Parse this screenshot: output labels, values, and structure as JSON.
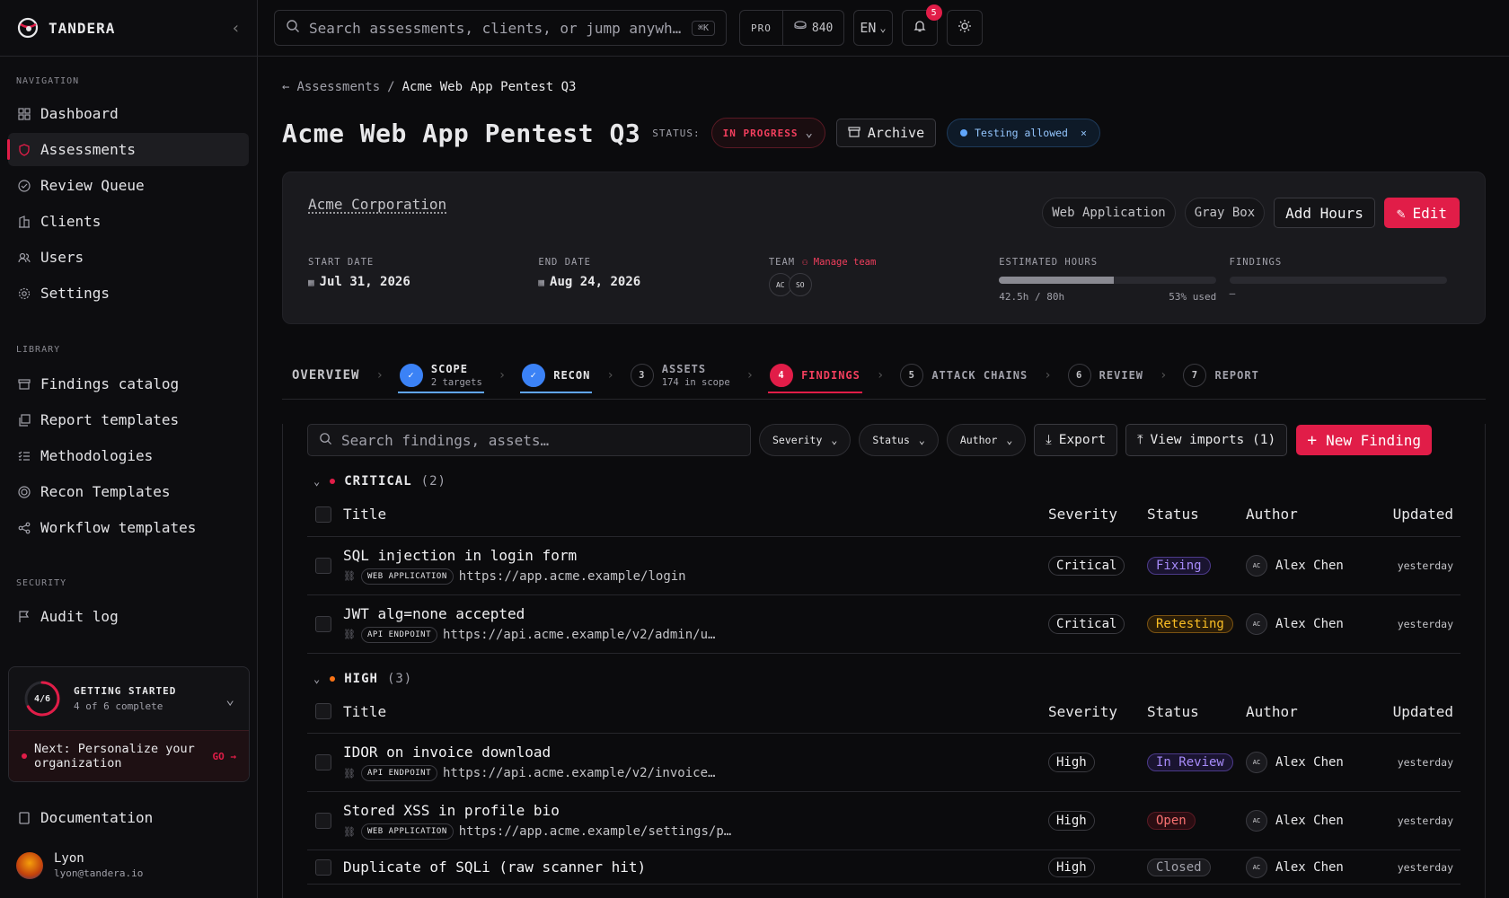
{
  "app": {
    "name": "TANDERA"
  },
  "sidebar": {
    "nav_heading": "NAVIGATION",
    "nav": [
      {
        "label": "Dashboard",
        "icon": "grid-icon"
      },
      {
        "label": "Assessments",
        "icon": "shield-icon",
        "active": true
      },
      {
        "label": "Review Queue",
        "icon": "check-circle-icon"
      },
      {
        "label": "Clients",
        "icon": "building-icon"
      },
      {
        "label": "Users",
        "icon": "users-icon"
      },
      {
        "label": "Settings",
        "icon": "gear-icon"
      }
    ],
    "library_heading": "LIBRARY",
    "library": [
      {
        "label": "Findings catalog",
        "icon": "archive-icon"
      },
      {
        "label": "Report templates",
        "icon": "copy-icon"
      },
      {
        "label": "Methodologies",
        "icon": "list-check-icon"
      },
      {
        "label": "Recon Templates",
        "icon": "target-icon"
      },
      {
        "label": "Workflow templates",
        "icon": "share-icon"
      }
    ],
    "security_heading": "SECURITY",
    "security": [
      {
        "label": "Audit log",
        "icon": "flag-icon"
      }
    ],
    "getting_started": {
      "progress_label": "4/6",
      "progress": 0.667,
      "title": "GETTING STARTED",
      "subtitle": "4 of 6 complete",
      "next": "Next: Personalize your organization",
      "go": "GO →"
    },
    "documentation": "Documentation",
    "user": {
      "name": "Lyon",
      "email": "lyon@tandera.io"
    }
  },
  "topbar": {
    "search_placeholder": "Search assessments, clients, or jump anywh…",
    "shortcut": "⌘K",
    "plan": "PRO",
    "credits": "840",
    "lang": "EN",
    "notifications": "5"
  },
  "breadcrumb": {
    "parent": "Assessments",
    "sep": "/",
    "current": "Acme Web App Pentest Q3"
  },
  "assessment": {
    "title": "Acme Web App Pentest Q3",
    "status_label": "STATUS:",
    "status": "IN PROGRESS",
    "archive": "Archive",
    "testing": "Testing allowed",
    "client": "Acme Corporation",
    "tags": [
      "Web Application",
      "Gray Box"
    ],
    "add_hours": "Add Hours",
    "edit": "Edit",
    "start_label": "START DATE",
    "start": "Jul 31, 2026",
    "end_label": "END DATE",
    "end": "Aug 24, 2026",
    "team_label": "TEAM",
    "manage_team": "Manage team",
    "team": [
      "AC",
      "SO"
    ],
    "hours_label": "ESTIMATED HOURS",
    "hours": "42.5h / 80h",
    "hours_used": "53% used",
    "hours_fraction": 0.53,
    "findings_label": "FINDINGS",
    "findings": "—"
  },
  "steps": [
    {
      "label": "OVERVIEW"
    },
    {
      "label": "SCOPE",
      "sub": "2 targets",
      "state": "done"
    },
    {
      "label": "RECON",
      "state": "done"
    },
    {
      "num": "3",
      "label": "ASSETS",
      "sub": "174 in scope"
    },
    {
      "num": "4",
      "label": "FINDINGS",
      "state": "current"
    },
    {
      "num": "5",
      "label": "ATTACK CHAINS"
    },
    {
      "num": "6",
      "label": "REVIEW"
    },
    {
      "num": "7",
      "label": "REPORT"
    }
  ],
  "findings_toolbar": {
    "search_placeholder": "Search findings, assets…",
    "severity": "Severity",
    "status": "Status",
    "author": "Author",
    "export": "Export",
    "imports": "View imports (1)",
    "new": "New Finding"
  },
  "columns": {
    "title": "Title",
    "severity": "Severity",
    "status": "Status",
    "author": "Author",
    "updated": "Updated"
  },
  "groups": [
    {
      "name": "CRITICAL",
      "count": "(2)",
      "color": "#e11d48",
      "rows": [
        {
          "title": "SQL injection in login form",
          "kind": "WEB APPLICATION",
          "url": "https://app.acme.example/login",
          "severity": "Critical",
          "status": "Fixing",
          "status_class": "fixing",
          "author_initials": "AC",
          "author": "Alex Chen",
          "updated": "yesterday"
        },
        {
          "title": "JWT alg=none accepted",
          "kind": "API ENDPOINT",
          "url": "https://api.acme.example/v2/admin/u…",
          "severity": "Critical",
          "status": "Retesting",
          "status_class": "retest",
          "author_initials": "AC",
          "author": "Alex Chen",
          "updated": "yesterday"
        }
      ]
    },
    {
      "name": "HIGH",
      "count": "(3)",
      "color": "#f97316",
      "rows": [
        {
          "title": "IDOR on invoice download",
          "kind": "API ENDPOINT",
          "url": "https://api.acme.example/v2/invoice…",
          "severity": "High",
          "status": "In Review",
          "status_class": "review",
          "author_initials": "AC",
          "author": "Alex Chen",
          "updated": "yesterday"
        },
        {
          "title": "Stored XSS in profile bio",
          "kind": "WEB APPLICATION",
          "url": "https://app.acme.example/settings/p…",
          "severity": "High",
          "status": "Open",
          "status_class": "open",
          "author_initials": "AC",
          "author": "Alex Chen",
          "updated": "yesterday"
        },
        {
          "title": "Duplicate of SQLi (raw scanner hit)",
          "kind": "",
          "url": "",
          "severity": "High",
          "status": "Closed",
          "status_class": "closed",
          "author_initials": "AC",
          "author": "Alex Chen",
          "updated": "yesterday"
        }
      ]
    }
  ]
}
